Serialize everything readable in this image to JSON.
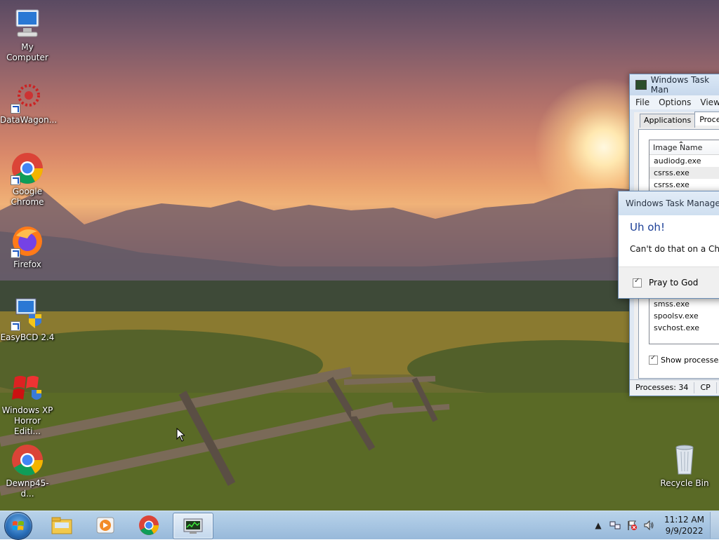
{
  "desktop": {
    "icons": [
      {
        "label": "My Computer",
        "icon": "computer-icon"
      },
      {
        "label": "DataWagon...",
        "icon": "datawagon-icon"
      },
      {
        "label": "Google Chrome",
        "icon": "chrome-icon"
      },
      {
        "label": "Firefox",
        "icon": "firefox-icon"
      },
      {
        "label": "EasyBCD 2.4",
        "icon": "easybcd-icon"
      },
      {
        "label": "Windows XP Horror Editi...",
        "icon": "windows-flag-shield-icon"
      },
      {
        "label": "Dewnp45-d...",
        "icon": "chrome-icon"
      },
      {
        "label": "Recycle Bin",
        "icon": "recycle-bin-icon"
      }
    ]
  },
  "task_manager": {
    "title": "Windows Task Man",
    "menu": [
      "File",
      "Options",
      "View"
    ],
    "tabs": [
      "Applications",
      "Processes"
    ],
    "column_header": "Image Name",
    "processes_top": [
      "audiodg.exe",
      "csrss.exe",
      "csrss.exe"
    ],
    "processes_bottom": [
      "smss.exe",
      "spoolsv.exe",
      "svchost.exe"
    ],
    "show_all_label": "Show processes f",
    "status_processes": "Processes: 34",
    "status_cpu": "CP"
  },
  "dialog": {
    "title": "Windows Task Manager",
    "heading": "Uh oh!",
    "message": "Can't do that on a Christ",
    "checkbox_label": "Pray to God",
    "checkbox_checked": true
  },
  "taskbar": {
    "pinned": [
      "explorer-icon",
      "media-player-icon",
      "chrome-icon",
      "task-manager-icon"
    ],
    "tray_icons": [
      "show-hidden-icons-chevron",
      "network-icon",
      "action-center-flag-icon",
      "volume-icon"
    ],
    "time": "11:12 AM",
    "date": "9/9/2022"
  }
}
